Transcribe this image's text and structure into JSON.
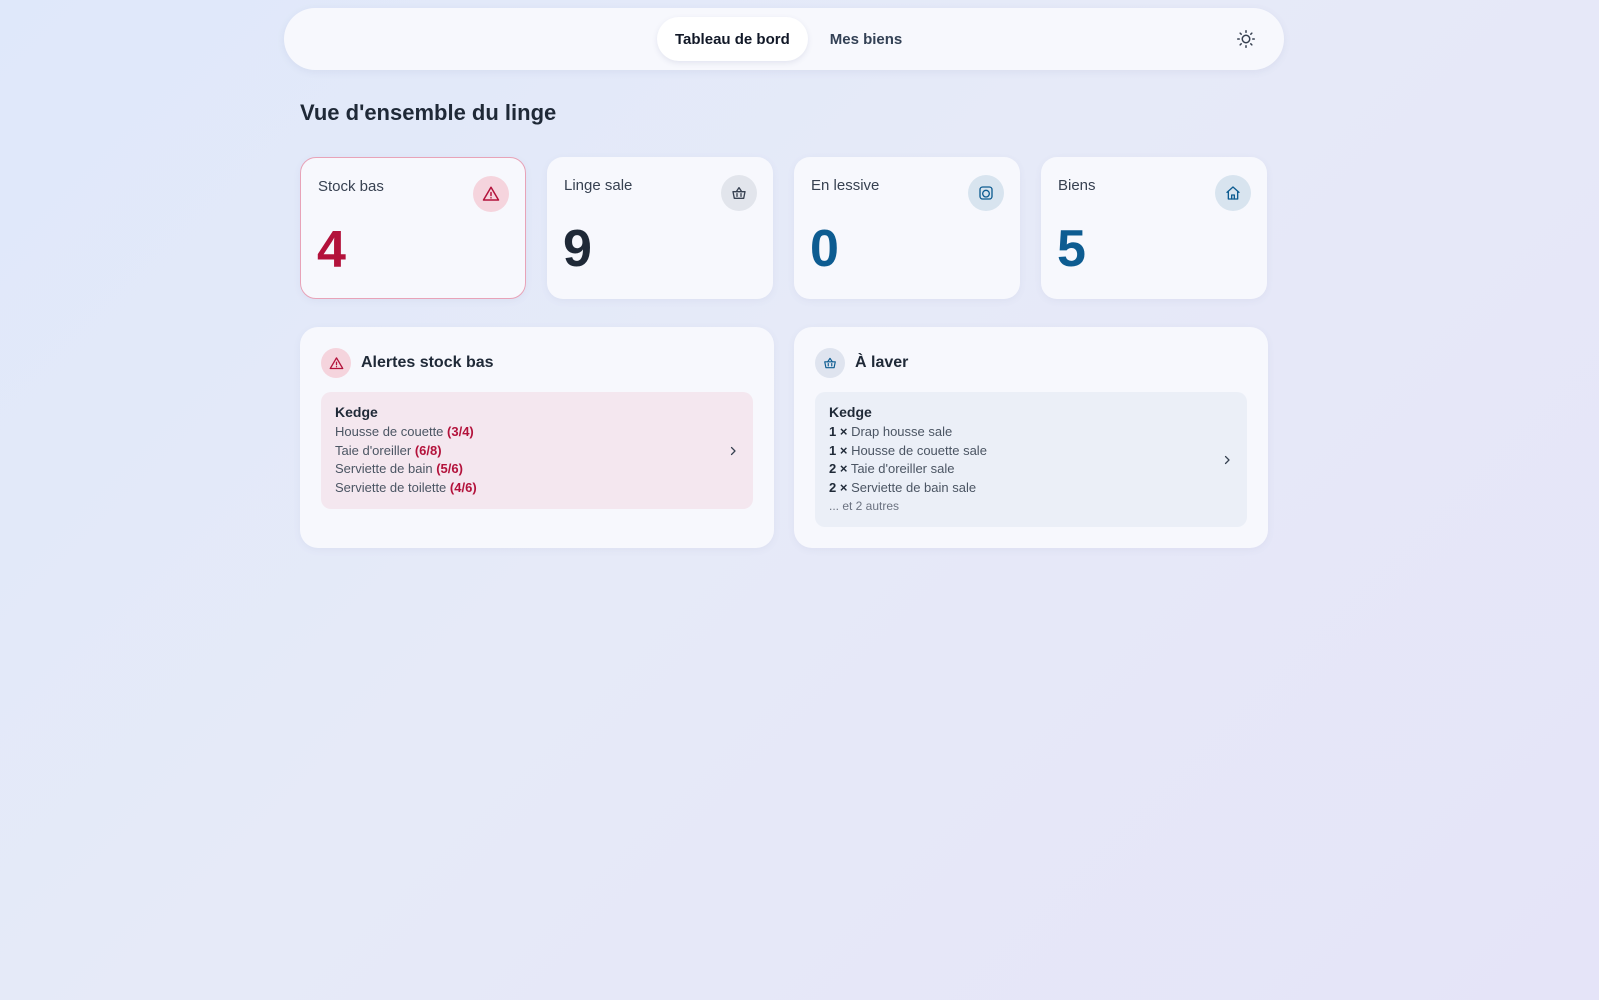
{
  "nav": {
    "tabs": [
      {
        "label": "Tableau de bord",
        "active": true
      },
      {
        "label": "Mes biens",
        "active": false
      }
    ],
    "theme_icon": "sun-icon"
  },
  "page": {
    "title": "Vue d'ensemble du linge"
  },
  "stats": [
    {
      "label": "Stock bas",
      "value": "4",
      "icon": "alert-triangle-icon",
      "color": "#b3123b",
      "icon_bg": "#f5d4dd"
    },
    {
      "label": "Linge sale",
      "value": "9",
      "icon": "basket-icon",
      "color": "#1f2937",
      "icon_bg": "#e2e5ec"
    },
    {
      "label": "En lessive",
      "value": "0",
      "icon": "washing-machine-icon",
      "color": "#0d5c91",
      "icon_bg": "#d8e4ef"
    },
    {
      "label": "Biens",
      "value": "5",
      "icon": "home-icon",
      "color": "#0d5c91",
      "icon_bg": "#d8e4ef"
    }
  ],
  "alerts_panel": {
    "title": "Alertes stock bas",
    "icon": "alert-triangle-icon",
    "group": {
      "name": "Kedge",
      "items": [
        {
          "label": "Housse de couette",
          "count": "(3/4)"
        },
        {
          "label": "Taie d'oreiller",
          "count": "(6/8)"
        },
        {
          "label": "Serviette de bain",
          "count": "(5/6)"
        },
        {
          "label": "Serviette de toilette",
          "count": "(4/6)"
        }
      ]
    }
  },
  "wash_panel": {
    "title": "À laver",
    "icon": "basket-icon",
    "group": {
      "name": "Kedge",
      "items": [
        {
          "qty": "1 ×",
          "label": "Drap housse sale"
        },
        {
          "qty": "1 ×",
          "label": "Housse de couette sale"
        },
        {
          "qty": "2 ×",
          "label": "Taie d'oreiller sale"
        },
        {
          "qty": "2 ×",
          "label": "Serviette de bain sale"
        }
      ],
      "more": "... et 2 autres"
    }
  },
  "colors": {
    "accent_red": "#b3123b",
    "accent_blue": "#0d5c91",
    "text_dark": "#1f2937"
  }
}
